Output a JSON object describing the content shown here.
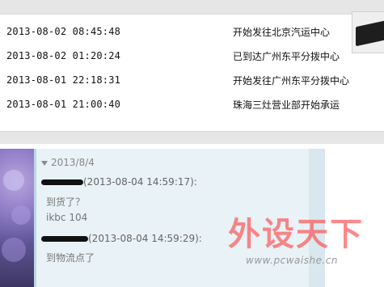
{
  "tracking": {
    "rows": [
      {
        "time": "2013-08-02  08:45:48",
        "status": "开始发往北京汽运中心"
      },
      {
        "time": "2013-08-02  01:20:24",
        "status": "已到达广州东平分拨中心"
      },
      {
        "time": "2013-08-01  22:18:31",
        "status": "开始发往广州东平分拨中心"
      },
      {
        "time": "2013-08-01  21:00:40",
        "status": "珠海三灶营业部开始承运"
      }
    ]
  },
  "chat": {
    "date_header": "2013/8/4",
    "messages": [
      {
        "sender_suffix": "(2013-08-04 14:59:17):",
        "lines": [
          "到货了？",
          "ikbc 104"
        ]
      },
      {
        "sender_suffix": "(2013-08-04 14:59:29):",
        "lines": [
          "到物流点了"
        ]
      }
    ]
  },
  "watermark": {
    "text": "外设天下",
    "url": "www.pcwaishe.cn"
  }
}
